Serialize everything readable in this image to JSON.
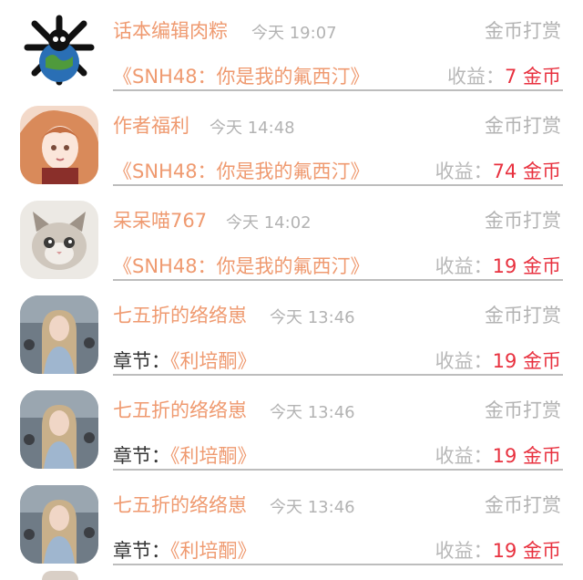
{
  "rows": [
    {
      "name": "话本编辑肉粽",
      "time": "今天 19:07",
      "action": "金币打赏",
      "prefix": "",
      "work": "《SNH48：你是我的氟西汀》",
      "earn_label": "收益：",
      "earn_amount": "7 金币",
      "avatar": "skull-logo"
    },
    {
      "name": "作者福利",
      "time": "今天 14:48",
      "action": "金币打赏",
      "prefix": "",
      "work": "《SNH48：你是我的氟西汀》",
      "earn_label": "收益：",
      "earn_amount": "74 金币",
      "avatar": "anime-girl"
    },
    {
      "name": "呆呆喵767",
      "time": "今天 14:02",
      "action": "金币打赏",
      "prefix": "",
      "work": "《SNH48：你是我的氟西汀》",
      "earn_label": "收益：",
      "earn_amount": "19 金币",
      "avatar": "kitten"
    },
    {
      "name": "七五折的络络崽",
      "time": "今天 13:46",
      "action": "金币打赏",
      "prefix": "章节：",
      "work": "《利培酮》",
      "earn_label": "收益：",
      "earn_amount": "19 金币",
      "avatar": "girl-photo"
    },
    {
      "name": "七五折的络络崽",
      "time": "今天 13:46",
      "action": "金币打赏",
      "prefix": "章节：",
      "work": "《利培酮》",
      "earn_label": "收益：",
      "earn_amount": "19 金币",
      "avatar": "girl-photo"
    },
    {
      "name": "七五折的络络崽",
      "time": "今天 13:46",
      "action": "金币打赏",
      "prefix": "章节：",
      "work": "《利培酮》",
      "earn_label": "收益：",
      "earn_amount": "19 金币",
      "avatar": "girl-photo"
    }
  ]
}
